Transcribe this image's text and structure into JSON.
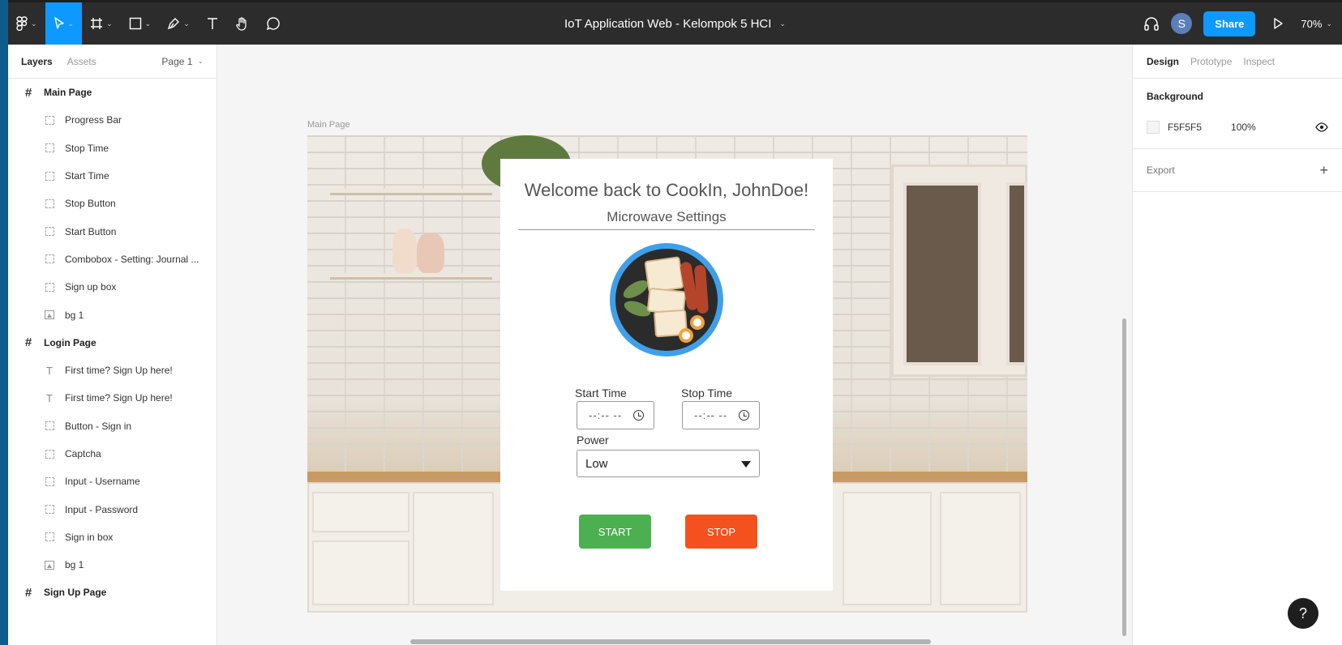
{
  "toolbar": {
    "title": "IoT Application Web - Kelompok 5 HCI",
    "avatar_initial": "S",
    "share_label": "Share",
    "zoom": "70%"
  },
  "left_panel": {
    "tabs": [
      "Layers",
      "Assets"
    ],
    "page_selector": "Page 1",
    "layers": [
      {
        "name": "Main Page",
        "kind": "frame"
      },
      {
        "name": "Progress Bar",
        "kind": "component"
      },
      {
        "name": "Stop Time",
        "kind": "component"
      },
      {
        "name": "Start Time",
        "kind": "component"
      },
      {
        "name": "Stop Button",
        "kind": "component"
      },
      {
        "name": "Start Button",
        "kind": "component"
      },
      {
        "name": "Combobox - Setting: Journal ...",
        "kind": "component"
      },
      {
        "name": "Sign up box",
        "kind": "component"
      },
      {
        "name": "bg 1",
        "kind": "image"
      },
      {
        "name": "Login Page",
        "kind": "frame"
      },
      {
        "name": "First time? Sign Up here!",
        "kind": "text"
      },
      {
        "name": "First time? Sign Up here!",
        "kind": "text"
      },
      {
        "name": "Button - Sign in",
        "kind": "component"
      },
      {
        "name": "Captcha",
        "kind": "component"
      },
      {
        "name": "Input - Username",
        "kind": "component"
      },
      {
        "name": "Input - Password",
        "kind": "component"
      },
      {
        "name": "Sign in box",
        "kind": "component"
      },
      {
        "name": "bg 1",
        "kind": "image"
      },
      {
        "name": "Sign Up Page",
        "kind": "frame"
      }
    ]
  },
  "canvas": {
    "frame_label": "Main Page",
    "card": {
      "title": "Welcome back to CookIn, JohnDoe!",
      "subtitle": "Microwave Settings",
      "start_time_label": "Start Time",
      "stop_time_label": "Stop Time",
      "start_time_value": "--:-- --",
      "stop_time_value": "--:-- --",
      "power_label": "Power",
      "power_value": "Low",
      "start_button": "START",
      "stop_button": "STOP"
    }
  },
  "right_panel": {
    "tabs": [
      "Design",
      "Prototype",
      "Inspect"
    ],
    "background_heading": "Background",
    "background_hex": "F5F5F5",
    "background_opacity": "100%",
    "export_label": "Export"
  },
  "colors": {
    "accent": "#0d99ff",
    "start_button": "#4caf50",
    "stop_button": "#f4511e",
    "canvas_bg": "#f5f5f5"
  },
  "help_label": "?"
}
